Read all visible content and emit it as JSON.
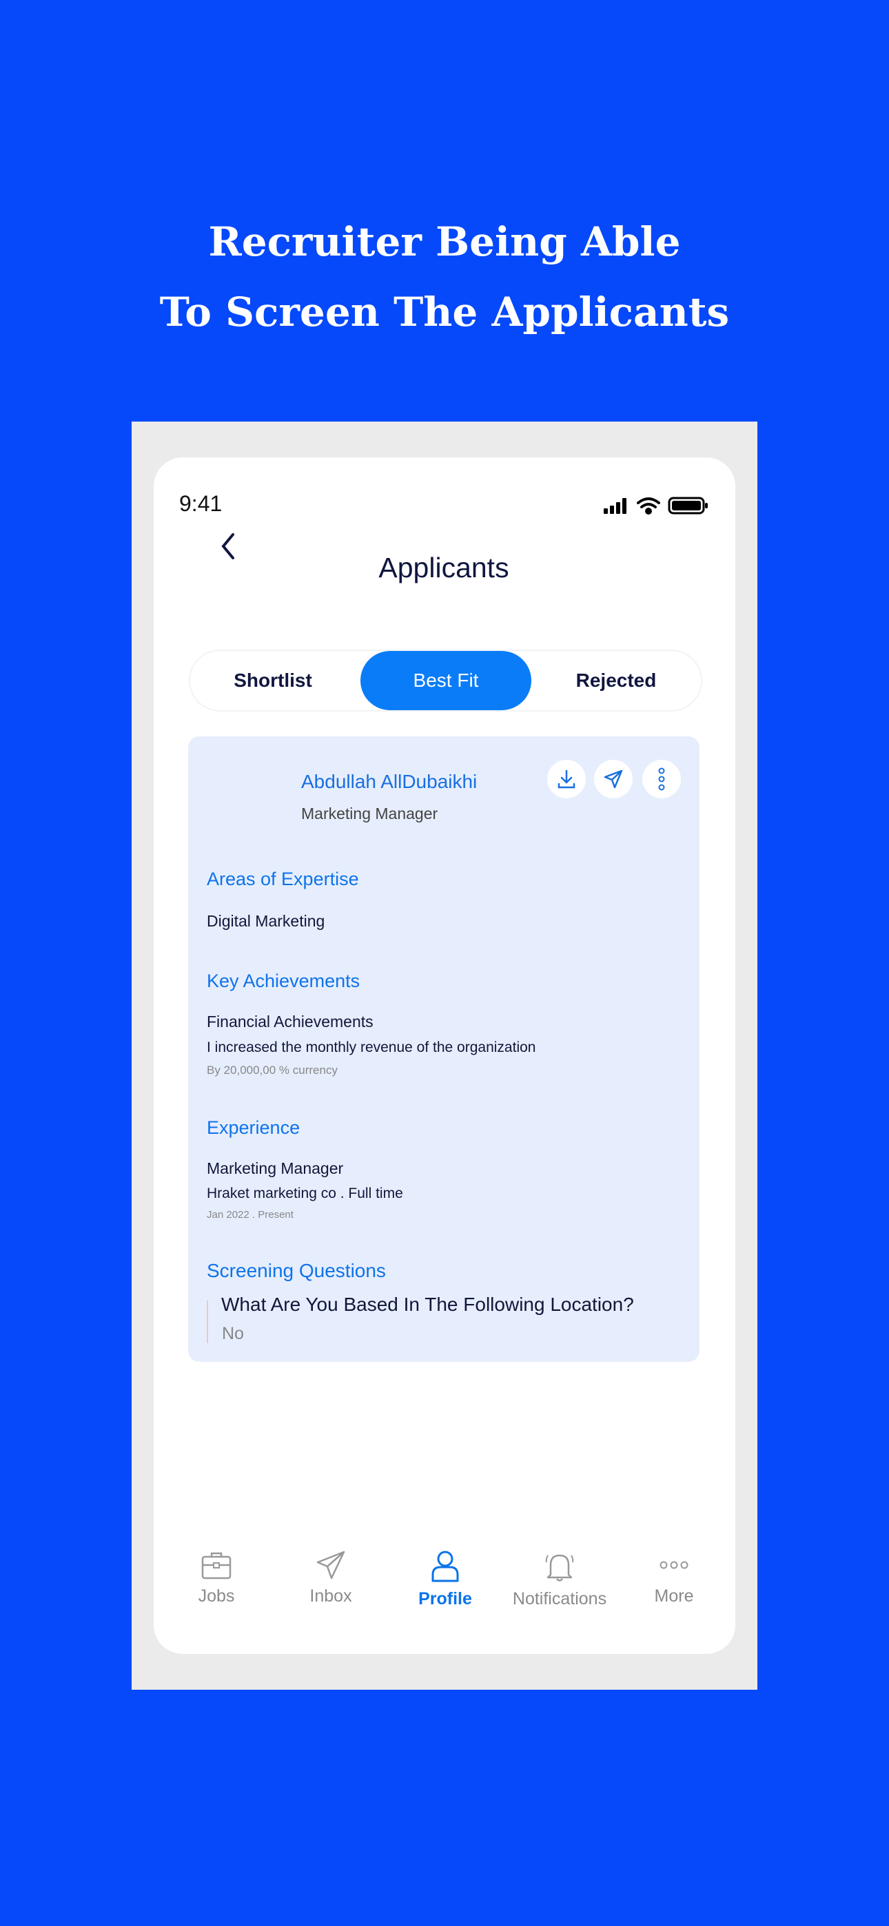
{
  "headline": {
    "line1": "Recruiter Being Able",
    "line2": "To Screen The Applicants"
  },
  "status_bar": {
    "time": "9:41"
  },
  "header": {
    "title": "Applicants"
  },
  "tabs": [
    {
      "label": "Shortlist",
      "active": false
    },
    {
      "label": "Best Fit",
      "active": true
    },
    {
      "label": "Rejected",
      "active": false
    }
  ],
  "applicant": {
    "name": "Abdullah AllDubaikhi",
    "role": "Marketing Manager",
    "actions": [
      "download-icon",
      "send-icon",
      "more-vertical-icon"
    ],
    "expertise": {
      "heading": "Areas of Expertise",
      "value": "Digital Marketing"
    },
    "achievements": {
      "heading": "Key Achievements",
      "title": "Financial Achievements",
      "description": "I increased the monthly revenue of the organization",
      "detail": "By 20,000,00 % currency"
    },
    "experience": {
      "heading": "Experience",
      "title": "Marketing Manager",
      "company": "Hraket marketing co . Full time",
      "period": "Jan 2022 . Present"
    },
    "screening": {
      "heading": "Screening Questions",
      "question": "What Are You Based In The Following Location?",
      "answer": "No"
    }
  },
  "bottom_nav": [
    {
      "label": "Jobs",
      "icon": "briefcase-icon",
      "active": false
    },
    {
      "label": "Inbox",
      "icon": "paper-plane-icon",
      "active": false
    },
    {
      "label": "Profile",
      "icon": "user-icon",
      "active": true
    },
    {
      "label": "Notifications",
      "icon": "bell-icon",
      "active": false
    },
    {
      "label": "More",
      "icon": "more-horizontal-icon",
      "active": false
    }
  ],
  "colors": {
    "background": "#0649fb",
    "accent": "#0a7cf8",
    "card": "#e6eefd",
    "text_dark": "#12163a"
  }
}
